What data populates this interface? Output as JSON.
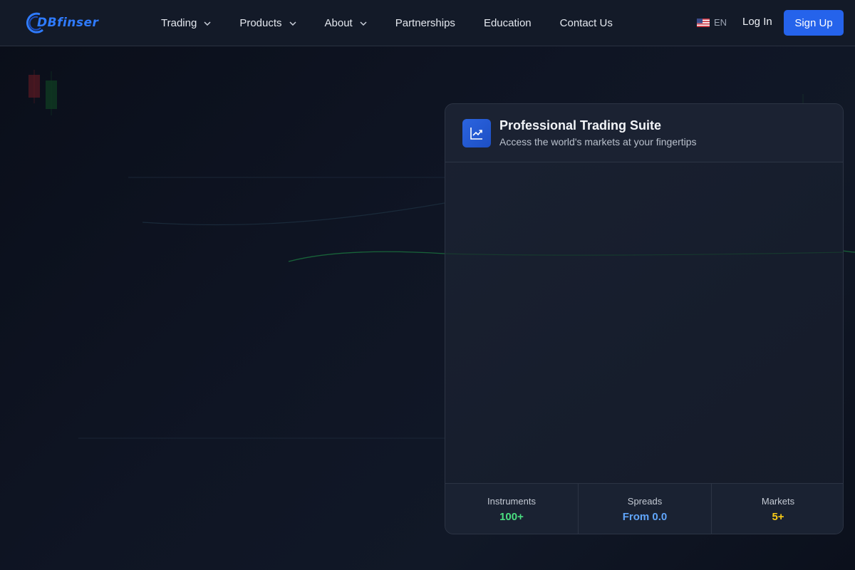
{
  "brand": {
    "name": "DBfinser",
    "color": "#2f7bff"
  },
  "nav": {
    "items": [
      {
        "label": "Trading",
        "dropdown": true
      },
      {
        "label": "Products",
        "dropdown": true
      },
      {
        "label": "About",
        "dropdown": true
      },
      {
        "label": "Partnerships",
        "dropdown": false
      },
      {
        "label": "Education",
        "dropdown": false
      },
      {
        "label": "Contact Us",
        "dropdown": false
      }
    ],
    "language": {
      "code": "EN",
      "flag": "us-flag-icon"
    },
    "login_label": "Log In",
    "signup_label": "Sign Up"
  },
  "card": {
    "title": "Professional Trading Suite",
    "subtitle": "Access the world's markets at your fingertips",
    "icon": "chart-trend-icon",
    "stats": [
      {
        "label": "Instruments",
        "value": "100+",
        "color": "#4ade80"
      },
      {
        "label": "Spreads",
        "value": "From 0.0",
        "color": "#60a5fa"
      },
      {
        "label": "Markets",
        "value": "5+",
        "color": "#facc15"
      }
    ]
  },
  "colors": {
    "accent": "#2563eb",
    "background": "#0a0e19"
  }
}
